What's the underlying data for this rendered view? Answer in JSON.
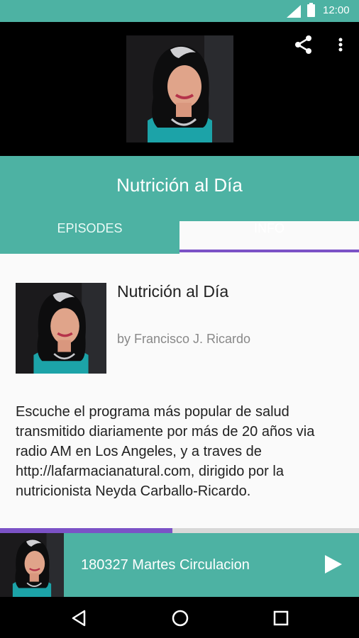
{
  "status_bar": {
    "time": "12:00",
    "icons": [
      "wifi-icon",
      "battery-icon"
    ]
  },
  "toolbar": {
    "actions": [
      "share-icon",
      "more-vert-icon"
    ]
  },
  "podcast": {
    "title": "Nutrición al Día"
  },
  "tabs": [
    {
      "label": "EPISODES",
      "selected": false
    },
    {
      "label": "INFO",
      "selected": true
    }
  ],
  "info": {
    "title": "Nutrición al Día",
    "author": "by Francisco J. Ricardo",
    "description": "Escuche el programa más popular de salud transmitido diariamente por más de 20 años via radio AM en Los Angeles, y a traves de http://lafarmacianatural.com, dirigido por la nutricionista Neyda Carballo-Ricardo."
  },
  "player": {
    "episode_title": "180327 Martes Circulacion",
    "progress": 0.48,
    "action": "play-icon"
  },
  "nav_bar": {
    "buttons": [
      "back-icon",
      "home-icon",
      "recents-icon"
    ]
  },
  "colors": {
    "primary": "#4db2a3",
    "accent": "#7b52c6",
    "background": "#fafafa",
    "text": "#212121",
    "secondary_text": "#888888"
  }
}
